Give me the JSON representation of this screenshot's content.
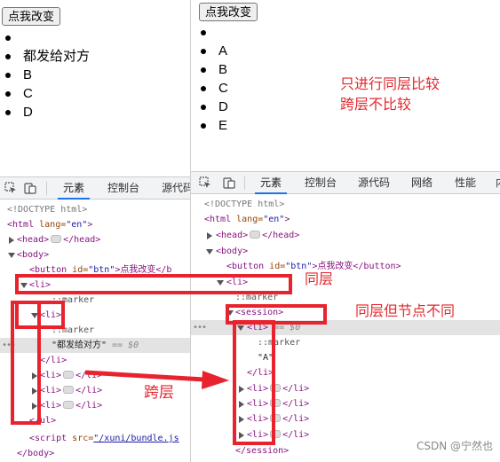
{
  "left": {
    "button_label": "点我改变",
    "list_items": [
      "",
      "都发给对方",
      "B",
      "C",
      "D"
    ],
    "devtools": {
      "tabs": [
        "元素",
        "控制台",
        "源代码"
      ],
      "active_tab": "元素",
      "lines": {
        "doctype": "<!DOCTYPE html>",
        "html_open": "<html",
        "lang_attr": " lang=",
        "lang_val": "\"en\"",
        "html_close": ">",
        "head": "<head>",
        "head_end": "</head>",
        "body": "<body>",
        "button_open": "<button",
        "button_attr": " id=",
        "button_val": "\"btn\"",
        "button_text": ">点我改变</b",
        "li_open": "<li>",
        "marker": "::marker",
        "text_node": "\"都发给对方\"",
        "eq_dollar": "== $0",
        "li_close": "</li>",
        "li_collapsed_open": "<li>",
        "li_collapsed_close": "</li>",
        "ul_close": "</ul>",
        "script_open": "<script",
        "script_attr": " src=",
        "script_val": "\"/xuni/bundle.js",
        "body_close": "</body>"
      }
    },
    "annotation": "跨层"
  },
  "right": {
    "button_label": "点我改变",
    "list_items": [
      "",
      "A",
      "B",
      "C",
      "D",
      "E"
    ],
    "annotation_lines": [
      "只进行同层比较",
      "跨层不比较"
    ],
    "devtools": {
      "tabs": [
        "元素",
        "控制台",
        "源代码",
        "网络",
        "性能",
        "内"
      ],
      "active_tab": "元素",
      "lines": {
        "doctype": "<!DOCTYPE html>",
        "html_open": "<html",
        "lang_attr": " lang=",
        "lang_val": "\"en\"",
        "html_close": ">",
        "head": "<head>",
        "head_end": "</head>",
        "body": "<body>",
        "button_open": "<button",
        "button_attr": " id=",
        "button_val": "\"btn\"",
        "button_text": ">点我改变</button>",
        "li_open": "<li>",
        "marker": "::marker",
        "session_open": "<session>",
        "eq_dollar": "== $0",
        "text_a": "\"A\"",
        "li_close": "</li>",
        "session_close": "</session>"
      }
    },
    "annotation_same_level": "同层",
    "annotation_same_level_diff_node": "同层但节点不同"
  },
  "watermark": "CSDN @宁然也",
  "colors": {
    "annotation_red": "#e0282e",
    "box_red": "#e8232d",
    "arrow_red": "#e8232d"
  }
}
